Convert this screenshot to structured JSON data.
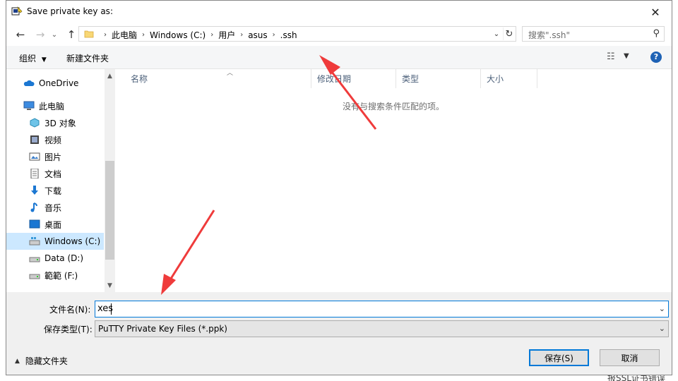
{
  "dialog": {
    "title": "Save private key as:",
    "close_glyph": "✕"
  },
  "address": {
    "crumbs": [
      "此电脑",
      "Windows (C:)",
      "用户",
      "asus",
      ".ssh"
    ]
  },
  "search": {
    "placeholder": "搜索\".ssh\""
  },
  "toolbar": {
    "organize_label": "组织",
    "new_folder_label": "新建文件夹"
  },
  "sidebar": {
    "items": [
      {
        "label": "OneDrive",
        "icon": "cloud-icon"
      },
      {
        "label": "此电脑",
        "icon": "computer-icon"
      },
      {
        "label": "3D 对象",
        "icon": "cube-icon"
      },
      {
        "label": "视频",
        "icon": "video-icon"
      },
      {
        "label": "图片",
        "icon": "picture-icon"
      },
      {
        "label": "文档",
        "icon": "document-icon"
      },
      {
        "label": "下载",
        "icon": "download-icon"
      },
      {
        "label": "音乐",
        "icon": "music-icon"
      },
      {
        "label": "桌面",
        "icon": "desktop-icon"
      },
      {
        "label": "Windows (C:)",
        "icon": "drive-icon",
        "selected": true
      },
      {
        "label": "Data (D:)",
        "icon": "drive-icon"
      },
      {
        "label": "範範 (F:)",
        "icon": "drive-icon"
      }
    ]
  },
  "columns": [
    "名称",
    "修改日期",
    "类型",
    "大小"
  ],
  "empty_message": "没有与搜索条件匹配的项。",
  "form": {
    "filename_label": "文件名(N):",
    "filename_value": "xes",
    "filetype_label": "保存类型(T):",
    "filetype_value": "PuTTY Private Key Files (*.ppk)"
  },
  "footer": {
    "hide_folders_label": "隐藏文件夹",
    "save_label": "保存(S)",
    "cancel_label": "取消"
  },
  "background": {
    "bottom_text": "报SSL证书错误"
  },
  "colors": {
    "accent": "#0078d7",
    "selection": "#cce8ff",
    "annotation_arrow": "#ef3b3b",
    "help": "#1e62b5"
  }
}
